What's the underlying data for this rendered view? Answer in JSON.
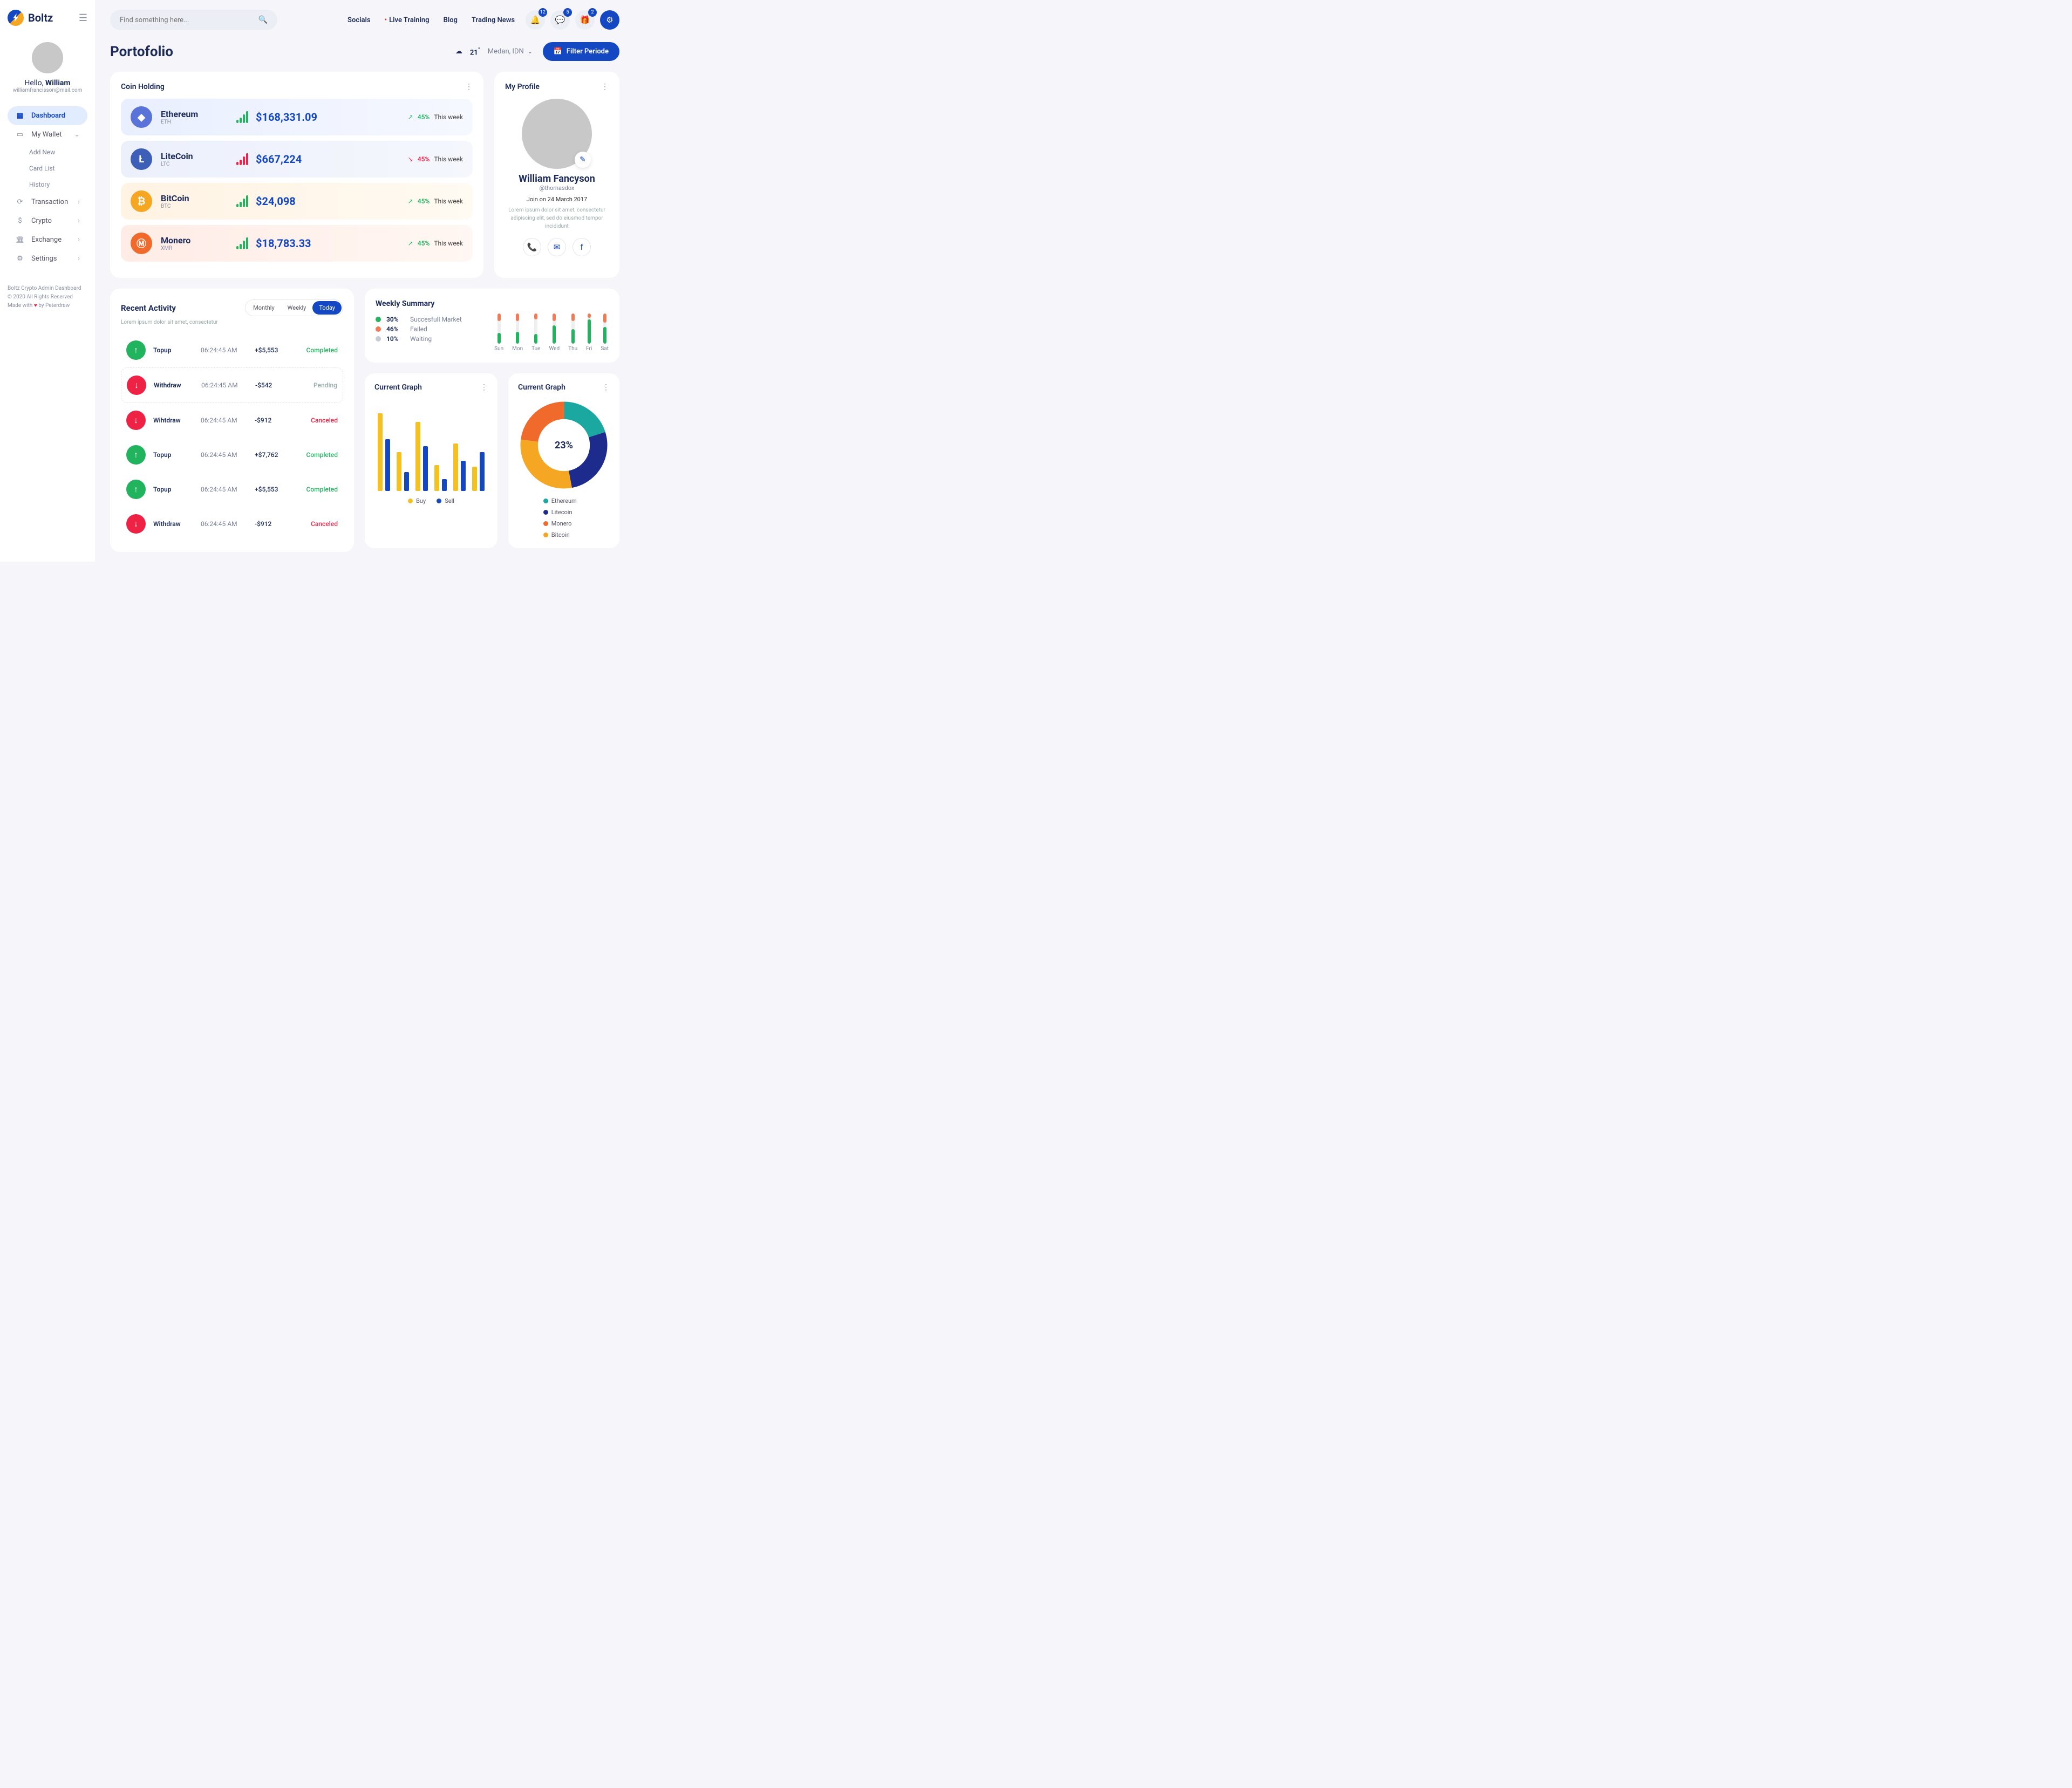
{
  "brand": "Boltz",
  "user": {
    "greeting_pre": "Hello, ",
    "greeting_name": "William",
    "email": "williamfrancisson@mail.com"
  },
  "search_placeholder": "Find something here...",
  "nav": [
    {
      "icon": "▦",
      "label": "Dashboard",
      "active": true
    },
    {
      "icon": "▭",
      "label": "My Wallet",
      "chev": "⌄"
    },
    {
      "label": "Add New",
      "sub": true
    },
    {
      "label": "Card List",
      "sub": true
    },
    {
      "label": "History",
      "sub": true
    },
    {
      "icon": "⟳",
      "label": "Transaction",
      "chev": "›"
    },
    {
      "icon": "$",
      "label": "Crypto",
      "chev": "›"
    },
    {
      "icon": "🏛",
      "label": "Exchange",
      "chev": "›"
    },
    {
      "icon": "⚙",
      "label": "Settings",
      "chev": "›"
    }
  ],
  "footer": {
    "l1": "Boltz Crypto Admin Dashboard",
    "l2": "© 2020 All Rights Reserved",
    "l3a": "Made with ",
    "l3b": " by Peterdraw"
  },
  "toplinks": [
    "Socials",
    "Live Training",
    "Blog",
    "Trading News"
  ],
  "badges": {
    "bell": "12",
    "chat": "5",
    "gift": "2"
  },
  "page_title": "Portofolio",
  "weather": {
    "temp": "21",
    "unit": "°",
    "loc": "Medan, IDN"
  },
  "filter_btn": "Filter Periode",
  "coin_title": "Coin Holding",
  "coins": [
    {
      "cls": "eth",
      "ic": "◆",
      "name": "Ethereum",
      "sym": "ETH",
      "val": "$168,331.09",
      "dir": "up",
      "pct": "45%",
      "lbl": "This week",
      "bars": [
        6,
        10,
        16,
        22
      ]
    },
    {
      "cls": "ltc",
      "ic": "Ł",
      "name": "LiteCoin",
      "sym": "LTC",
      "val": "$667,224",
      "dir": "dn",
      "pct": "45%",
      "lbl": "This week",
      "bars": [
        6,
        10,
        16,
        22
      ]
    },
    {
      "cls": "btc",
      "ic": "₿",
      "name": "BitCoin",
      "sym": "BTC",
      "val": "$24,098",
      "dir": "up",
      "pct": "45%",
      "lbl": "This week",
      "bars": [
        6,
        10,
        16,
        22
      ]
    },
    {
      "cls": "xmr",
      "ic": "Ⓜ",
      "name": "Monero",
      "sym": "XMR",
      "val": "$18,783.33",
      "dir": "up",
      "pct": "45%",
      "lbl": "This week",
      "bars": [
        6,
        10,
        16,
        22
      ]
    }
  ],
  "profile": {
    "title": "My Profile",
    "name": "William Fancyson",
    "handle": "@thomasdox",
    "join": "Join on 24 March 2017",
    "bio": "Lorem ipsum dolor sit amet, consectetur adipiscing elit, sed do eiusmod tempor incididunt"
  },
  "recent": {
    "title": "Recent Activity",
    "sub": "Lorem ipsum dolor sit amet, consectetur",
    "tabs": [
      "Monthly",
      "Weekly",
      "Today"
    ],
    "active_tab": 2,
    "rows": [
      {
        "dir": "up",
        "name": "Topup",
        "time": "06:24:45 AM",
        "amt": "+$5,553",
        "status": "Completed"
      },
      {
        "dir": "dn",
        "name": "Withdraw",
        "time": "06:24:45 AM",
        "amt": "-$542",
        "status": "Pending"
      },
      {
        "dir": "dn",
        "name": "Wihtdraw",
        "time": "06:24:45 AM",
        "amt": "-$912",
        "status": "Canceled"
      },
      {
        "dir": "up",
        "name": "Topup",
        "time": "06:24:45 AM",
        "amt": "+$7,762",
        "status": "Completed"
      },
      {
        "dir": "up",
        "name": "Topup",
        "time": "06:24:45 AM",
        "amt": "+$5,553",
        "status": "Completed"
      },
      {
        "dir": "dn",
        "name": "Withdraw",
        "time": "06:24:45 AM",
        "amt": "-$912",
        "status": "Canceled"
      }
    ]
  },
  "weekly": {
    "title": "Weekly Summary",
    "legend": [
      {
        "color": "#21b35e",
        "pct": "30%",
        "label": "Succesfull Market"
      },
      {
        "color": "#f07b56",
        "pct": "46%",
        "label": "Failed"
      },
      {
        "color": "#c8cad4",
        "pct": "10%",
        "label": "Waiting"
      }
    ],
    "days": [
      "Sun",
      "Mon",
      "Tue",
      "Wed",
      "Thu",
      "Fri",
      "Sat"
    ]
  },
  "graph1": {
    "title": "Current Graph",
    "legend": [
      {
        "c": "#f5c022",
        "l": "Buy"
      },
      {
        "c": "#1448c2",
        "l": "Sell"
      }
    ]
  },
  "graph2": {
    "title": "Current Graph",
    "center": "23%",
    "legend": [
      {
        "c": "#1aa8a0",
        "l": "Ethereum"
      },
      {
        "c": "#1c2b8c",
        "l": "Litecoin"
      },
      {
        "c": "#f06a2b",
        "l": "Monero"
      },
      {
        "c": "#f5a623",
        "l": "Bitcoin"
      }
    ]
  },
  "chart_data": [
    {
      "type": "bar",
      "title": "Weekly Summary",
      "categories": [
        "Sun",
        "Mon",
        "Tue",
        "Wed",
        "Thu",
        "Fri",
        "Sat"
      ],
      "series": [
        {
          "name": "Succesfull Market",
          "color": "#21b35e",
          "values": [
            35,
            40,
            32,
            60,
            48,
            80,
            55
          ]
        },
        {
          "name": "Failed",
          "color": "#f07b56",
          "values": [
            25,
            25,
            20,
            25,
            25,
            15,
            30
          ]
        }
      ],
      "ylim": [
        0,
        100
      ]
    },
    {
      "type": "bar",
      "title": "Current Graph (Buy/Sell)",
      "categories": [
        "1",
        "2",
        "3",
        "4",
        "5",
        "6"
      ],
      "series": [
        {
          "name": "Buy",
          "color": "#f5c022",
          "values": [
            90,
            45,
            80,
            30,
            55,
            28
          ]
        },
        {
          "name": "Sell",
          "color": "#1448c2",
          "values": [
            60,
            22,
            52,
            14,
            35,
            45
          ]
        }
      ],
      "ylim": [
        0,
        100
      ]
    },
    {
      "type": "pie",
      "title": "Current Graph (Holdings)",
      "center_label": "23%",
      "categories": [
        "Ethereum",
        "Litecoin",
        "Bitcoin",
        "Monero"
      ],
      "values": [
        20,
        27,
        30,
        23
      ],
      "colors": [
        "#1aa8a0",
        "#1c2b8c",
        "#f5a623",
        "#f06a2b"
      ]
    }
  ]
}
